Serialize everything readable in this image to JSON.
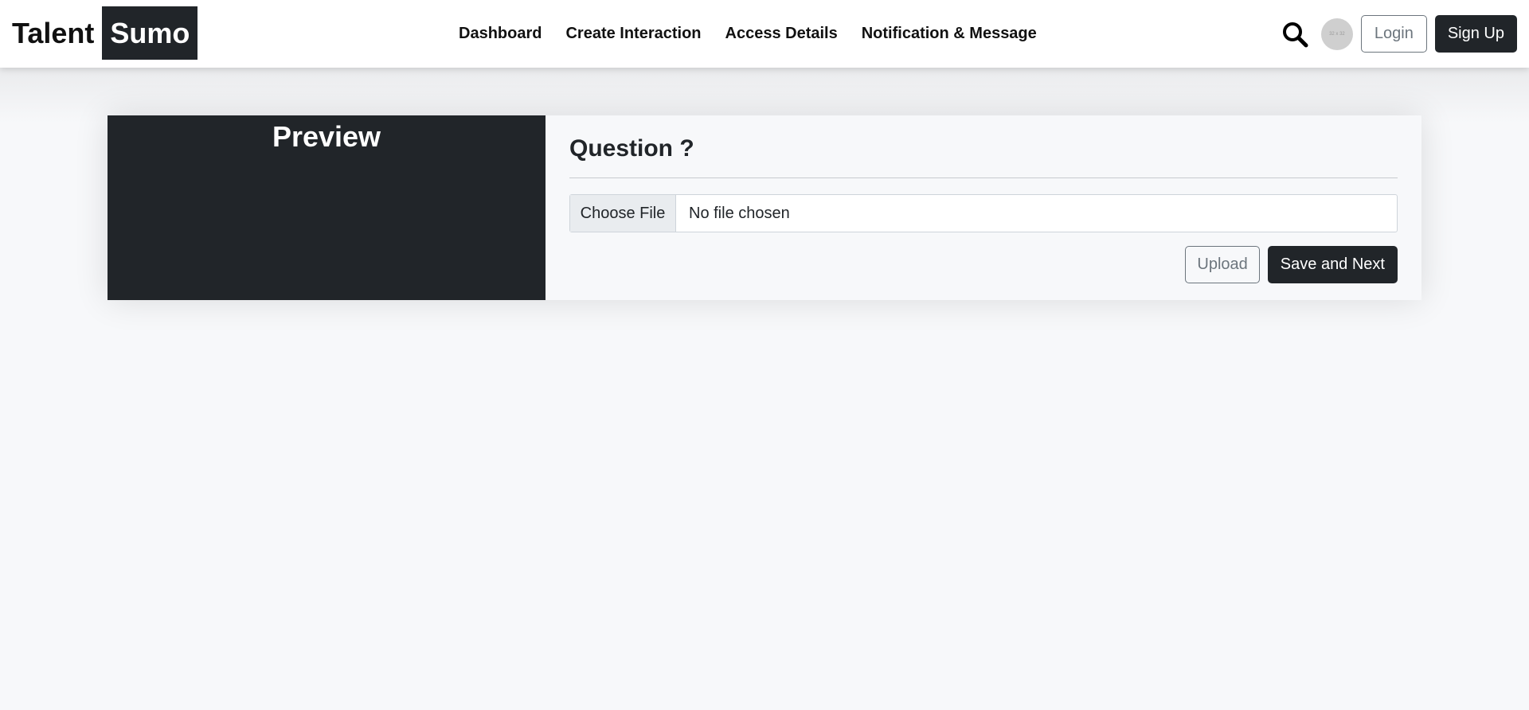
{
  "brand": {
    "part1": "Talent",
    "part2": "Sumo"
  },
  "nav": {
    "items": [
      {
        "label": "Dashboard"
      },
      {
        "label": "Create Interaction"
      },
      {
        "label": "Access Details"
      },
      {
        "label": "Notification & Message"
      }
    ]
  },
  "header": {
    "search_icon": "search-icon",
    "avatar_text": "32 x 32",
    "login_label": "Login",
    "signup_label": "Sign Up"
  },
  "preview": {
    "title": "Preview"
  },
  "form": {
    "question_title": "Question ?",
    "choose_file_label": "Choose File",
    "file_status": "No file chosen",
    "upload_label": "Upload",
    "save_next_label": "Save and Next"
  },
  "colors": {
    "dark": "#212529",
    "background": "#f7f8fa",
    "muted": "#6c757d"
  }
}
